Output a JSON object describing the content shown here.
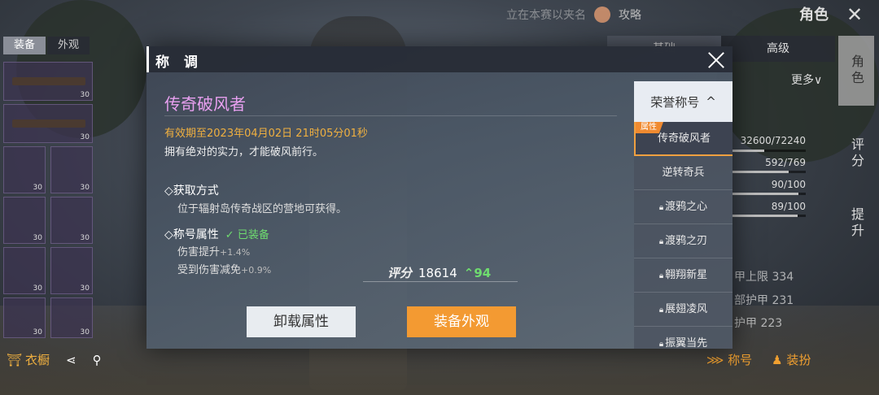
{
  "left": {
    "tabs": [
      "装备",
      "外观"
    ],
    "slot_counts": [
      "30",
      "30",
      "30",
      "30",
      "30",
      "30",
      "30",
      "30",
      "30",
      "30"
    ],
    "wardrobe": "衣橱"
  },
  "top": {
    "hint": "立在本赛以夹名",
    "strategy": "攻略",
    "role": "角色"
  },
  "right_tabs": [
    "基础",
    "高级"
  ],
  "more": "更多",
  "side_tabs": [
    "角色",
    "评分",
    "提升"
  ],
  "stats": [
    "32600/72240",
    "592/769",
    "90/100",
    "89/100"
  ],
  "stat_levels": [
    0.45,
    0.77,
    0.9,
    0.89
  ],
  "armor": [
    "甲上限 334",
    "部护甲 231",
    "护甲 223"
  ],
  "bottom_right": [
    "称号",
    "装扮"
  ],
  "modal": {
    "title": "称 调",
    "name": "传奇破风者",
    "expire": "有效期至2023年04月02日 21时05分01秒",
    "desc": "拥有绝对的实力，才能破风前行。",
    "obtain_head": "◇获取方式",
    "obtain_body": "位于辐射岛传奇战区的营地可获得。",
    "attr_head": "◇称号属性",
    "equipped": "已装备",
    "attr1": "伤害提升",
    "attr1_val": "+1.4%",
    "attr2": "受到伤害减免",
    "attr2_val": "+0.9%",
    "score_label": "评分",
    "score_value": "18614",
    "score_up": "94",
    "btn_unload": "卸载属性",
    "btn_equip": "装备外观",
    "list_head": "荣誉称号",
    "list_tag": "属性",
    "list": [
      "传奇破风者",
      "逆转奇兵",
      "渡鸦之心",
      "渡鸦之刃",
      "翱翔新星",
      "展翅凌风",
      "振翼当先"
    ]
  }
}
